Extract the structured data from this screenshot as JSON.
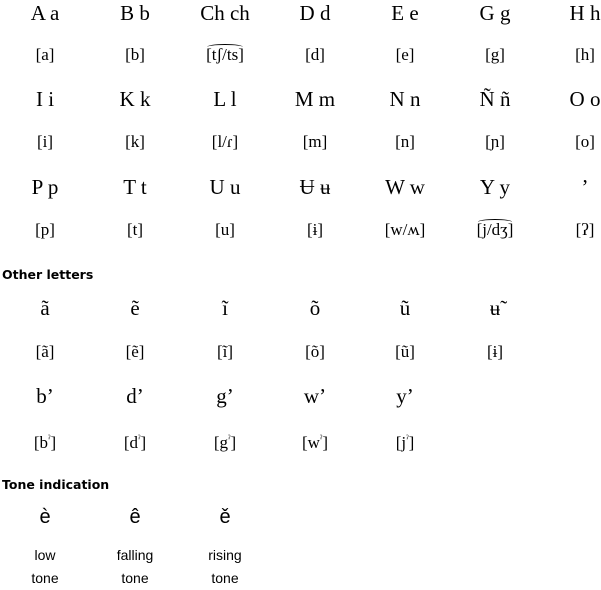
{
  "alphabet": {
    "rows": [
      {
        "letters": [
          "A a",
          "B b",
          "Ch ch",
          "D d",
          "E e",
          "G g",
          "H h"
        ],
        "ipa": [
          "[a]",
          "[b]",
          "[tʃ/ts]",
          "[d]",
          "[e]",
          "[g]",
          "[h]"
        ]
      },
      {
        "letters": [
          "I i",
          "K k",
          "L l",
          "M m",
          "N n",
          "Ñ ñ",
          "O o"
        ],
        "ipa": [
          "[i]",
          "[k]",
          "[l/ɾ]",
          "[m]",
          "[n]",
          "[ɲ]",
          "[o]"
        ]
      },
      {
        "letters": [
          "P p",
          "T t",
          "U u",
          "Ʉ ʉ",
          "W w",
          "Y y",
          "’"
        ],
        "ipa": [
          "[p]",
          "[t]",
          "[u]",
          "[ɨ]",
          "[w/ʍ]",
          "[j/dʒ]",
          "[ʔ]"
        ]
      }
    ]
  },
  "other_letters": {
    "heading": "Other letters",
    "rows": [
      {
        "letters": [
          "ã",
          "ẽ",
          "ĩ",
          "õ",
          "ũ",
          "ʉ̃"
        ],
        "ipa": [
          "[ã]",
          "[ẽ]",
          "[ĩ]",
          "[õ]",
          "[ũ]",
          "[ɨ]"
        ]
      },
      {
        "letters": [
          "b’",
          "d’",
          "g’",
          "w’",
          "y’"
        ],
        "ipa_base": [
          "[b",
          "[d",
          "[g",
          "[w",
          "[j"
        ],
        "ipa_mark": [
          "ˀ",
          "ˀ",
          "ˀ",
          "ˀ",
          "ˀ"
        ],
        "ipa_close": [
          "]",
          "]",
          "]",
          "]",
          "]"
        ]
      }
    ]
  },
  "tone_indication": {
    "heading": "Tone indication",
    "items": [
      {
        "letter": "è",
        "label_1": "low",
        "label_2": "tone"
      },
      {
        "letter": "ê",
        "label_1": "falling",
        "label_2": "tone"
      },
      {
        "letter": "ě",
        "label_1": "rising",
        "label_2": "tone"
      }
    ]
  }
}
